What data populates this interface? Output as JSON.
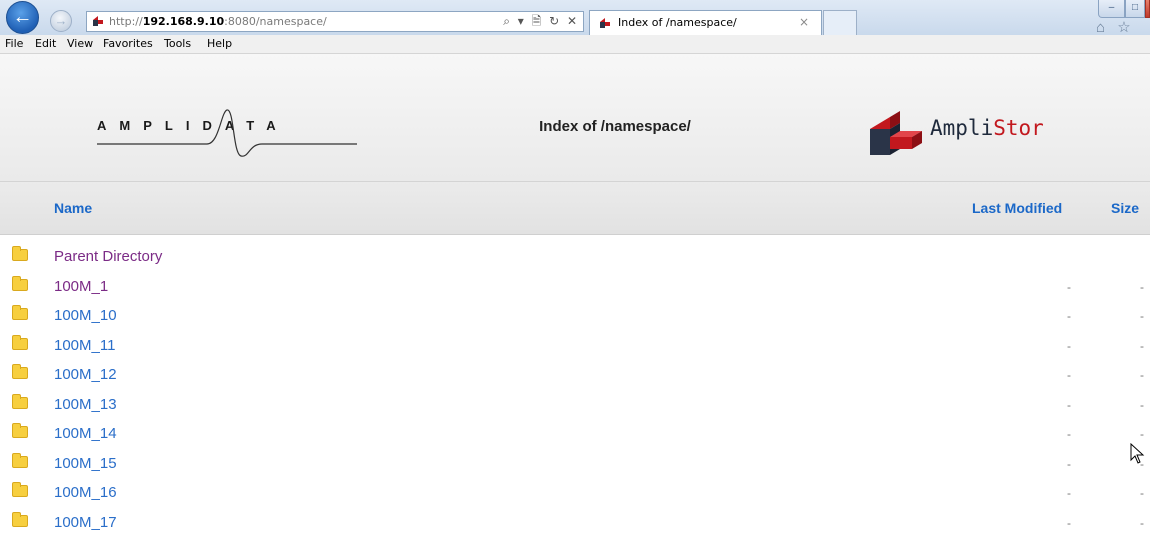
{
  "browser": {
    "url_prefix": "http://",
    "url_host": "192.168.9.10",
    "url_rest": ":8080/namespace/",
    "address_tools": "⌕ ▾ 🗎 ↻ ✕",
    "tab_title": "Index of /namespace/",
    "tab_close": "×",
    "toolbar_icons": "⌂ ☆",
    "back_glyph": "←",
    "forward_glyph": "→",
    "window_min": "–",
    "window_max": "□"
  },
  "menu": {
    "items": [
      "File",
      "Edit",
      "View",
      "Favorites",
      "Tools",
      "Help"
    ]
  },
  "header": {
    "left_logo_text": "AMPLIDATA",
    "title": "Index of /namespace/",
    "right_logo_text_a": "Ampli",
    "right_logo_text_b": "Stor"
  },
  "table": {
    "columns": {
      "name": "Name",
      "last_modified": "Last Modified",
      "size": "Size"
    },
    "rows": [
      {
        "name": "Parent Directory",
        "visited": true,
        "modified": "",
        "size": ""
      },
      {
        "name": "100M_1",
        "visited": true,
        "modified": "-",
        "size": "-"
      },
      {
        "name": "100M_10",
        "visited": false,
        "modified": "-",
        "size": "-"
      },
      {
        "name": "100M_11",
        "visited": false,
        "modified": "-",
        "size": "-"
      },
      {
        "name": "100M_12",
        "visited": false,
        "modified": "-",
        "size": "-"
      },
      {
        "name": "100M_13",
        "visited": false,
        "modified": "-",
        "size": "-"
      },
      {
        "name": "100M_14",
        "visited": false,
        "modified": "-",
        "size": "-"
      },
      {
        "name": "100M_15",
        "visited": false,
        "modified": "-",
        "size": "-"
      },
      {
        "name": "100M_16",
        "visited": false,
        "modified": "-",
        "size": "-"
      },
      {
        "name": "100M_17",
        "visited": false,
        "modified": "-",
        "size": "-"
      }
    ]
  },
  "colors": {
    "link": "#2a6ec9",
    "visited_link": "#7b2b86",
    "column_header": "#1b68c8",
    "brand_red": "#c2181e",
    "folder": "#f7cf3f"
  }
}
